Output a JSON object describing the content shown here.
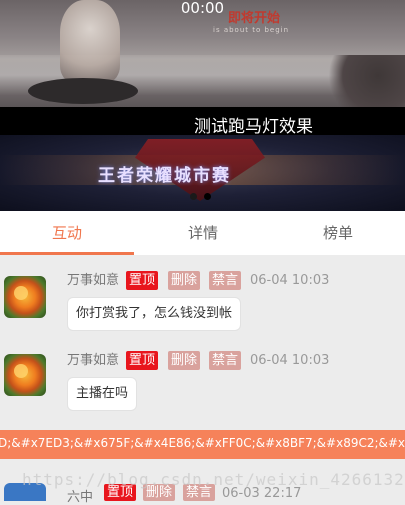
{
  "video": {
    "time": "00:00",
    "title": "即将开始",
    "subtitle": "is about to begin"
  },
  "marquee": {
    "text": "测试跑马灯效果"
  },
  "banner": {
    "title": "王者荣耀城市赛"
  },
  "tabs": [
    {
      "label": "互动",
      "active": true
    },
    {
      "label": "详情",
      "active": false
    },
    {
      "label": "榜单",
      "active": false
    }
  ],
  "messages": [
    {
      "name": "万事如意",
      "pin": "置顶",
      "delete": "删除",
      "mute": "禁言",
      "time": "06-04 10:03",
      "text": "你打赏我了，怎么钱没到帐"
    },
    {
      "name": "万事如意",
      "pin": "置顶",
      "delete": "删除",
      "mute": "禁言",
      "time": "06-04 10:03",
      "text": "主播在吗"
    }
  ],
  "notice": {
    "text": "D;&#x7ED3;&#x675F;&#x4E86;&#xFF0C;&#x8BF7;&#x89C2;&#x770B;&#"
  },
  "partial_message": {
    "name": "六中",
    "pin": "置顶",
    "delete": "删除",
    "mute": "禁言",
    "time": "06-03 22:17"
  },
  "watermark": "https://blog.csdn.net/weixin_42661321",
  "colors": {
    "accent": "#f0764d",
    "pin": "#e8161d",
    "muted_badge": "#d9a29d",
    "notice_bar": "#f6825a"
  }
}
